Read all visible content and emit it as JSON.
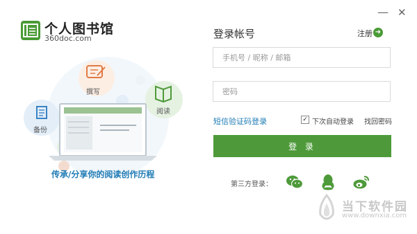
{
  "window": {
    "minimize": "—",
    "close": "✕"
  },
  "logo": {
    "title": "个人图书馆",
    "subtitle": "360doc.com"
  },
  "illustration": {
    "bubbles": [
      "撰写",
      "阅读",
      "备份"
    ],
    "slogan": "传承/分享你的阅读创作历程"
  },
  "form": {
    "title": "登录帐号",
    "register": "注册",
    "account_placeholder": "手机号 / 昵称 / 邮箱",
    "password_placeholder": "密码",
    "sms_login": "短信验证码登录",
    "auto_login": "下次自动登录",
    "auto_login_checked": true,
    "forgot_password": "找回密码",
    "login_button": "登 录",
    "third_party_label": "第三方登录：",
    "third_party": [
      "wechat-icon",
      "qq-icon",
      "weibo-icon"
    ]
  },
  "watermark": {
    "name": "当下软件园",
    "url": "www.downxia.com"
  },
  "colors": {
    "brand_green": "#4e9a3a",
    "link_blue": "#1f7bb5"
  }
}
